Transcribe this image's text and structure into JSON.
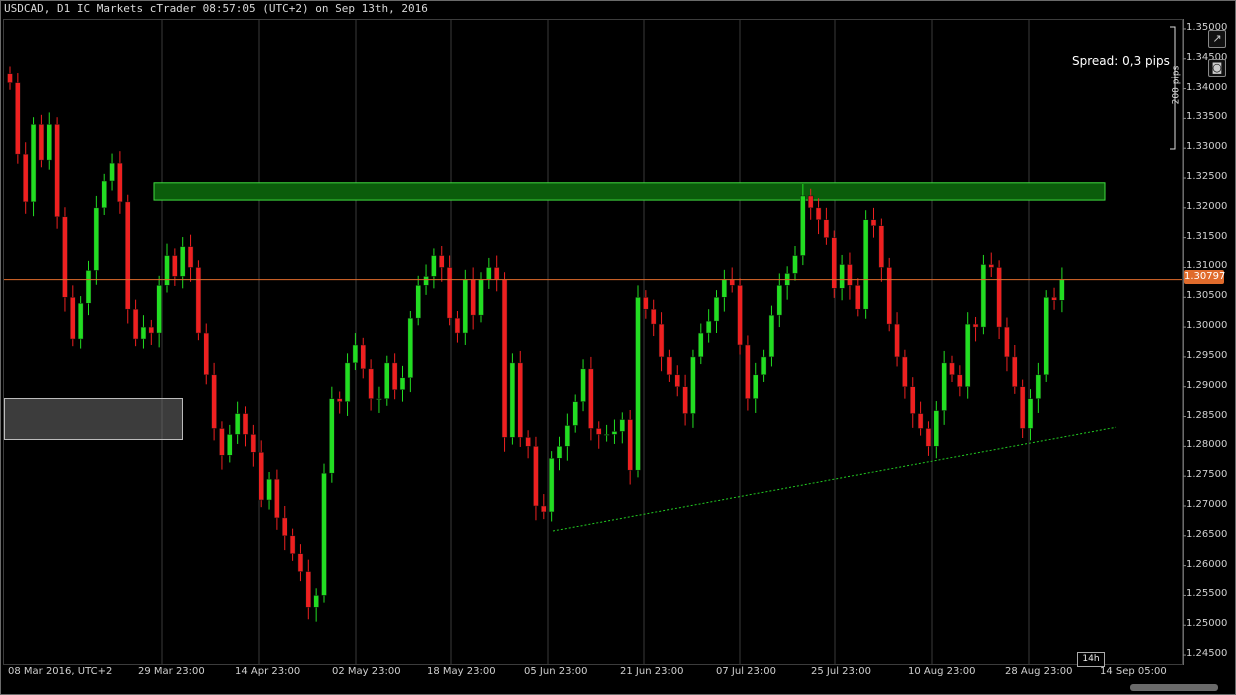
{
  "header": {
    "title": "USDCAD, D1 IC Markets cTrader 08:57:05 (UTC+2) on Sep 13th, 2016"
  },
  "overlay": {
    "spread": "Spread: 0,3 pips",
    "scale_label": "200 pips",
    "timeframe_badge": "14h",
    "current_price": "1.30797"
  },
  "icons": {
    "popout": "popout-icon",
    "camera": "camera-icon"
  },
  "colors": {
    "bull": "#22dd22",
    "bear": "#ee2020",
    "price_line": "#e06b2c",
    "zone": "#0b5d0b",
    "trendline": "#22cc22"
  },
  "chart_data": {
    "type": "candlestick",
    "y_ticks": [
      "1.35000",
      "1.34500",
      "1.34000",
      "1.33500",
      "1.33000",
      "1.32500",
      "1.32000",
      "1.31500",
      "1.31000",
      "1.30500",
      "1.30000",
      "1.29500",
      "1.29000",
      "1.28500",
      "1.28000",
      "1.27500",
      "1.27000",
      "1.26500",
      "1.26000",
      "1.25500",
      "1.25000",
      "1.24500"
    ],
    "x_ticks": [
      "08 Mar 2016, UTC+2",
      "29 Mar 23:00",
      "14 Apr 23:00",
      "02 May 23:00",
      "18 May 23:00",
      "05 Jun 23:00",
      "21 Jun 23:00",
      "07 Jul 23:00",
      "25 Jul 23:00",
      "10 Aug 23:00",
      "28 Aug 23:00",
      "14 Sep 05:00"
    ],
    "ylim": [
      1.2435,
      1.3515
    ],
    "current_price": 1.30797,
    "resistance_zone": [
      1.3213,
      1.3242
    ],
    "trendline": {
      "from_close": 1.2658,
      "to_close": 1.2832
    },
    "closes": [
      1.341,
      1.329,
      1.321,
      1.334,
      1.328,
      1.334,
      1.3185,
      1.305,
      1.298,
      1.304,
      1.3095,
      1.32,
      1.3245,
      1.3275,
      1.321,
      1.303,
      1.298,
      1.3,
      1.299,
      1.307,
      1.312,
      1.3085,
      1.3135,
      1.31,
      1.299,
      1.292,
      1.283,
      1.2785,
      1.282,
      1.2855,
      1.282,
      1.279,
      1.271,
      1.2745,
      1.268,
      1.265,
      1.262,
      1.259,
      1.253,
      1.255,
      1.2755,
      1.288,
      1.2875,
      1.294,
      1.297,
      1.293,
      1.288,
      1.288,
      1.294,
      1.2895,
      1.2915,
      1.3015,
      1.307,
      1.3085,
      1.312,
      1.31,
      1.3015,
      1.299,
      1.308,
      1.302,
      1.308,
      1.31,
      1.308,
      1.2815,
      1.294,
      1.2815,
      1.28,
      1.27,
      1.269,
      1.278,
      1.28,
      1.2835,
      1.2875,
      1.293,
      1.283,
      1.282,
      1.282,
      1.2825,
      1.2845,
      1.276,
      1.305,
      1.303,
      1.3005,
      1.295,
      1.292,
      1.29,
      1.2855,
      1.295,
      1.299,
      1.301,
      1.305,
      1.308,
      1.307,
      1.297,
      1.288,
      1.292,
      1.295,
      1.302,
      1.307,
      1.309,
      1.312,
      1.322,
      1.32,
      1.318,
      1.315,
      1.3065,
      1.3105,
      1.307,
      1.303,
      1.318,
      1.317,
      1.31,
      1.3005,
      1.295,
      1.29,
      1.2855,
      1.283,
      1.28,
      1.286,
      1.294,
      1.292,
      1.29,
      1.3005,
      1.3,
      1.3105,
      1.31,
      1.3,
      1.295,
      1.29,
      1.283,
      1.288,
      1.292,
      1.305,
      1.3045,
      1.308
    ]
  }
}
